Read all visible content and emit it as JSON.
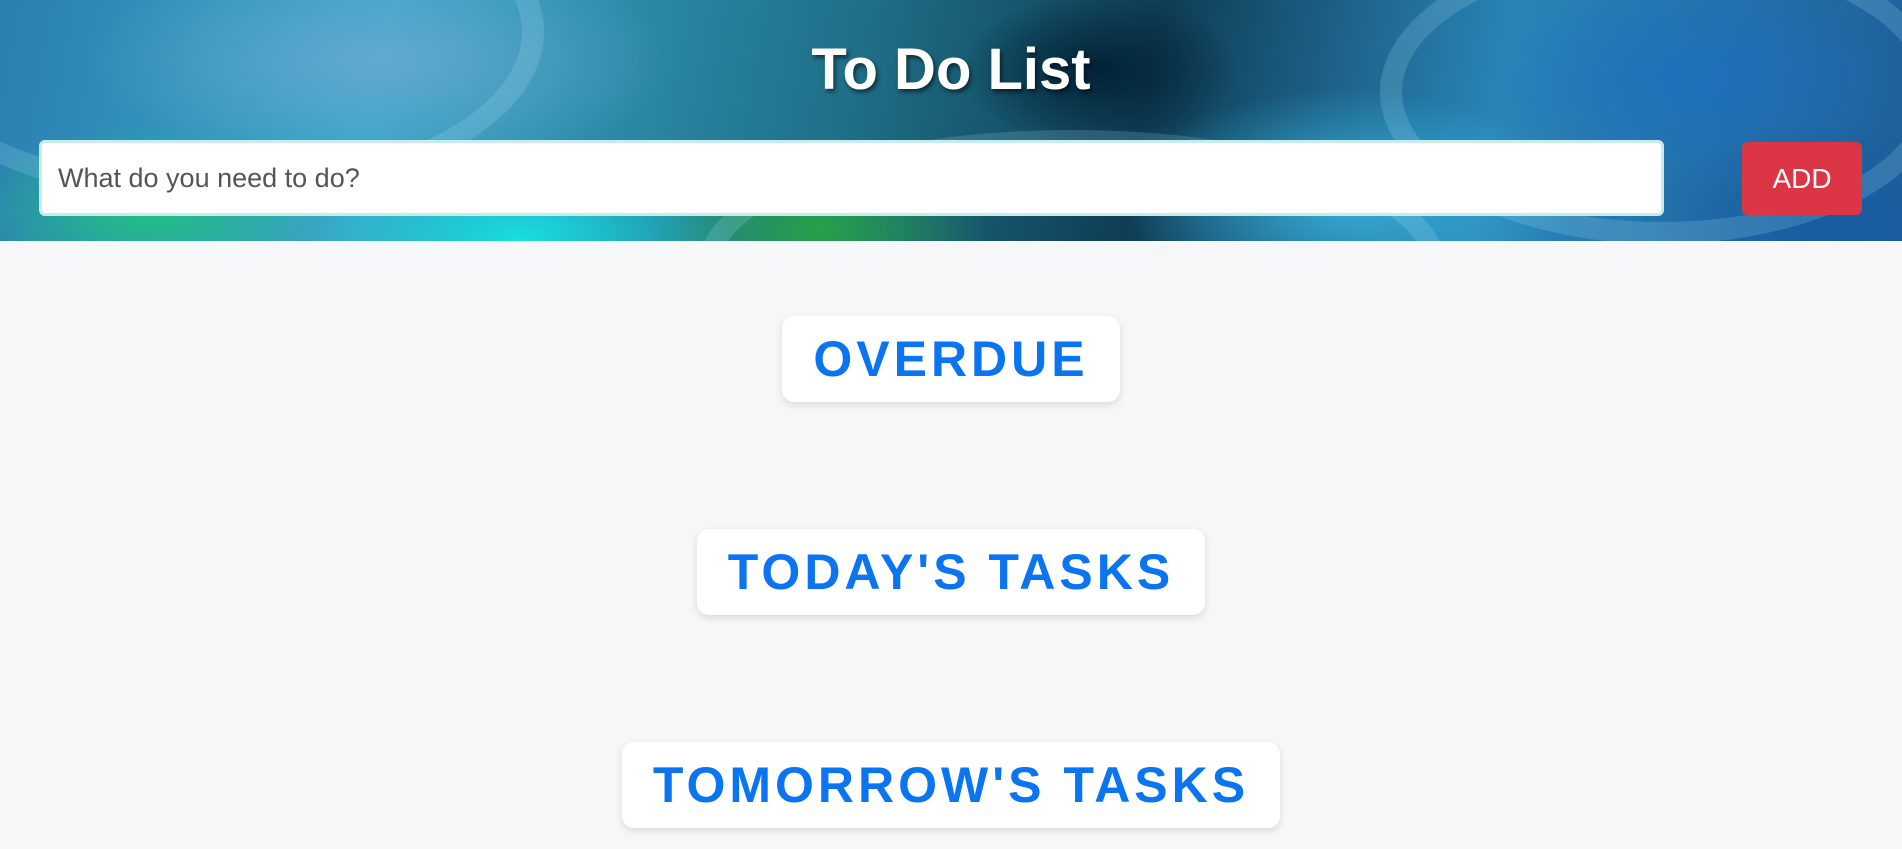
{
  "header": {
    "title": "To Do List"
  },
  "task_form": {
    "input_value": "",
    "input_placeholder": "What do you need to do?",
    "add_label": "ADD"
  },
  "sections": {
    "overdue": "OVERDUE",
    "today": "TODAY'S TASKS",
    "tomorrow": "TOMORROW'S TASKS"
  },
  "colors": {
    "accent_text": "#0b74f0",
    "add_button": "#dc3545",
    "page_background": "#f6f7f9"
  }
}
